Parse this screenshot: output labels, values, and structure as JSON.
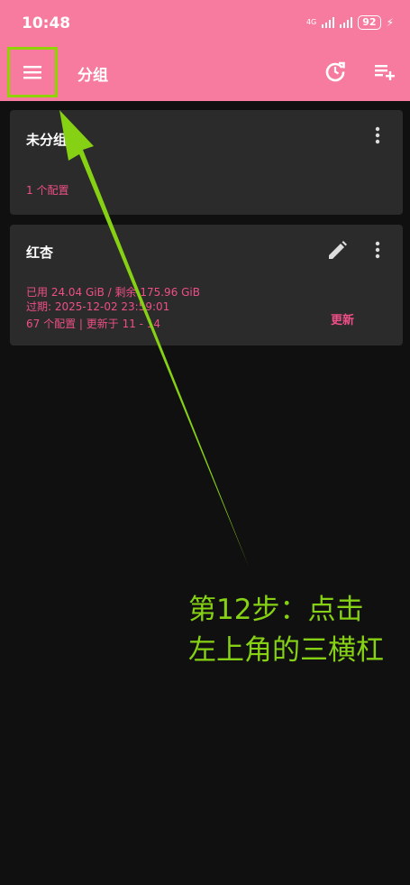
{
  "status": {
    "time": "10:48",
    "network": "4G",
    "battery": "92"
  },
  "toolbar": {
    "title": "分组"
  },
  "groups": [
    {
      "name": "未分组",
      "configs": "1 个配置"
    },
    {
      "name": "红杏",
      "usage": "已用 24.04 GiB / 剩余 175.96 GiB",
      "expiry": "过期: 2025-12-02 23:59:01",
      "configs": "67 个配置 | 更新于 11 - 14",
      "update_label": "更新"
    }
  ],
  "annotation": {
    "line1": "第12步：点击",
    "line2": "左上角的三横杠",
    "color": "#86d114"
  },
  "colors": {
    "appbar": "#f77b9e",
    "accent": "#ee4f86",
    "card": "#2b2b2b",
    "background": "#101010",
    "highlight": "#8fd400"
  }
}
